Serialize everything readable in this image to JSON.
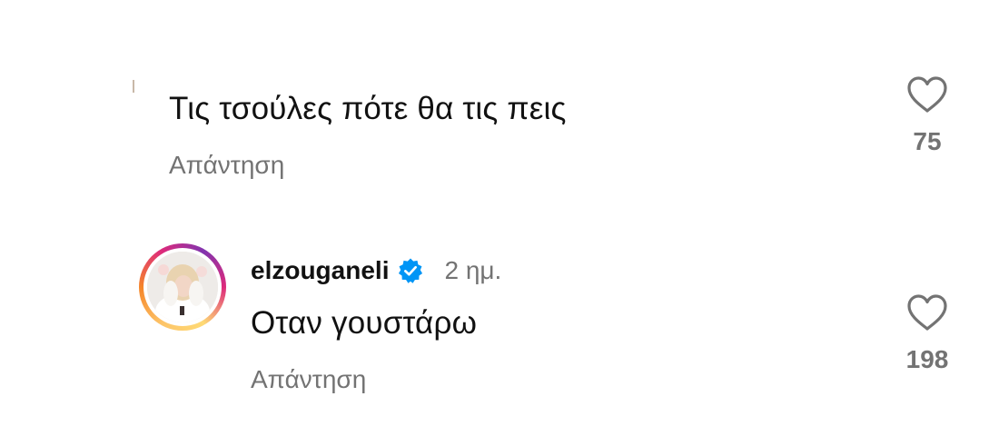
{
  "comments": [
    {
      "text": "Τις τσούλες πότε θα τις πεις",
      "reply_label": "Απάντηση",
      "likes": "75",
      "like_icon": "heart-outline"
    },
    {
      "username": "elzouganeli",
      "verified": true,
      "timestamp": "2 ημ.",
      "text": "Οταν γουστάρω",
      "reply_label": "Απάντηση",
      "likes": "198",
      "like_icon": "heart-outline",
      "avatar_story_ring": true
    }
  ],
  "colors": {
    "text": "#111111",
    "secondary": "#737373",
    "verified": "#0095f6",
    "ring_gradient": [
      "#feda75",
      "#f58529",
      "#dd2a7b",
      "#8134af"
    ]
  }
}
